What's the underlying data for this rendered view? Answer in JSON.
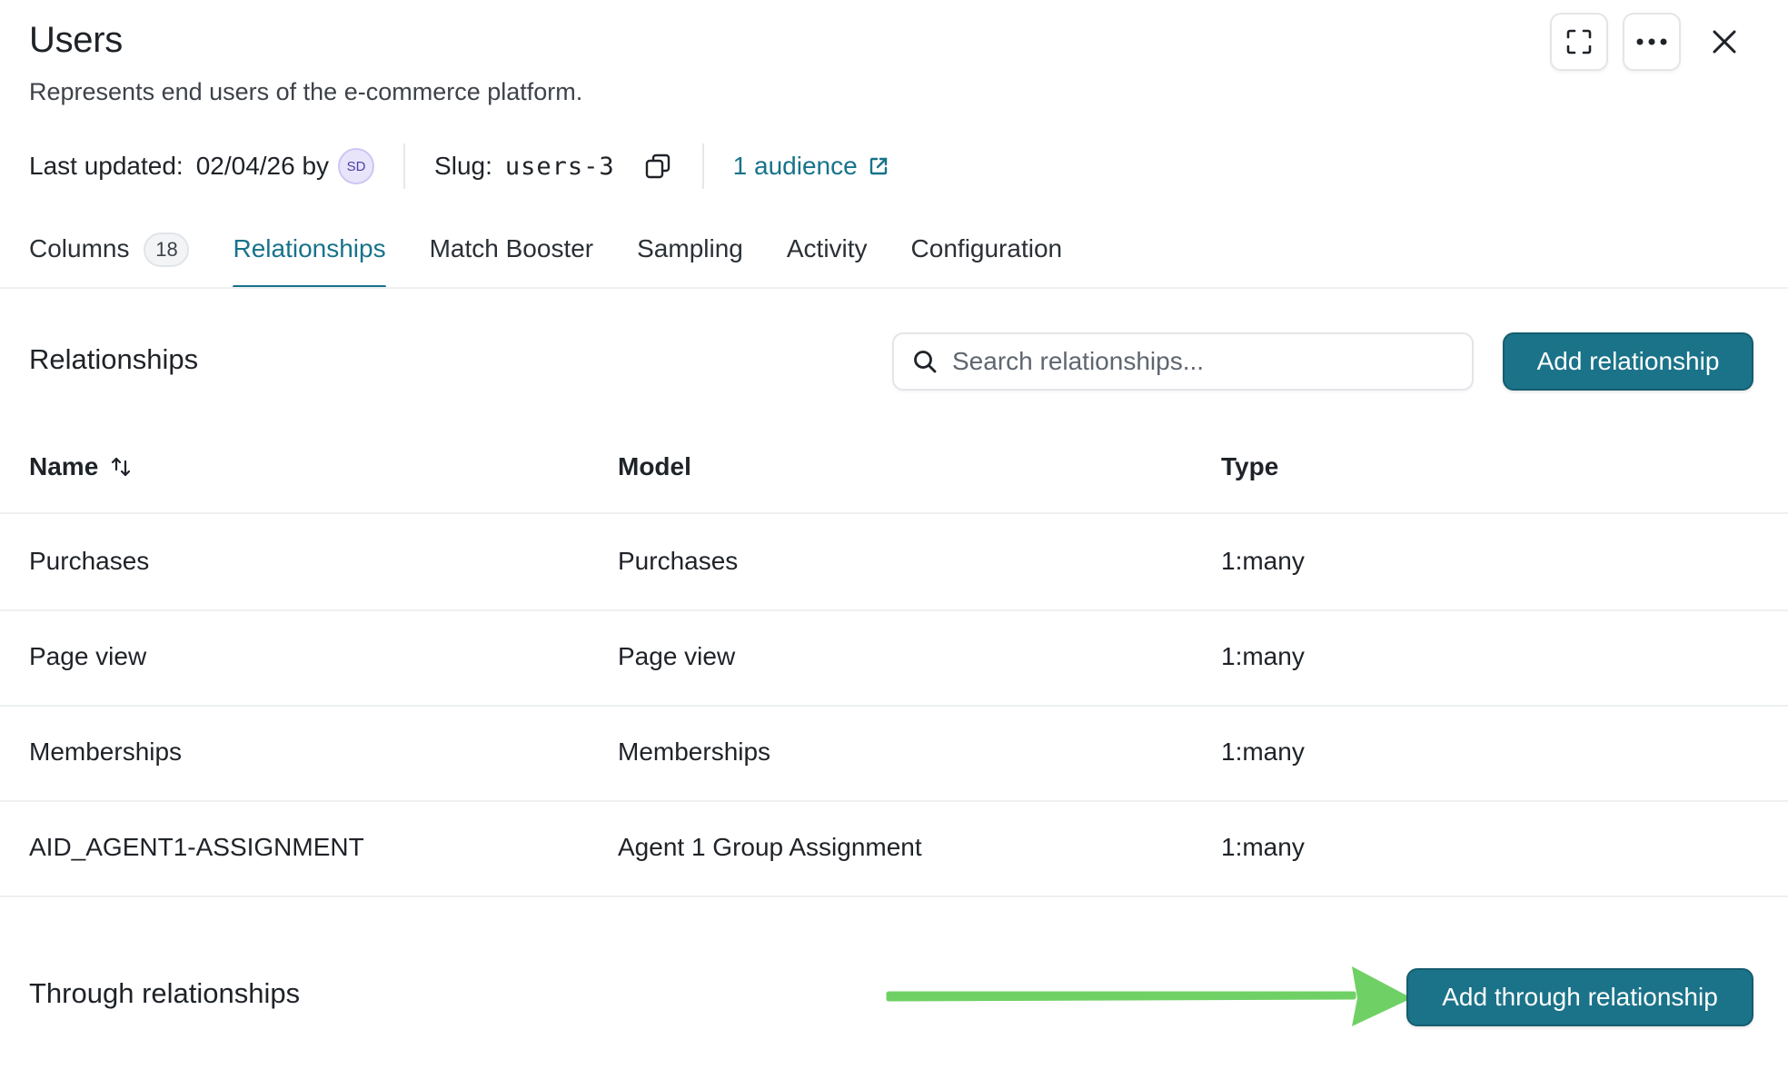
{
  "header": {
    "title": "Users",
    "description": "Represents end users of the e-commerce platform.",
    "actions": {
      "fullscreen_icon": "expand-corners-icon",
      "more_icon": "more-horizontal-icon",
      "close_icon": "close-icon"
    }
  },
  "meta": {
    "last_updated_label": "Last updated:",
    "last_updated_value": "02/04/26 by",
    "user_initials": "SD",
    "slug_label": "Slug:",
    "slug_value": "users-3",
    "copy_icon": "copy-icon",
    "audience_link": "1 audience",
    "external_icon": "external-link-icon"
  },
  "tabs": [
    {
      "label": "Columns",
      "count": "18",
      "active": false
    },
    {
      "label": "Relationships",
      "active": true
    },
    {
      "label": "Match Booster",
      "active": false
    },
    {
      "label": "Sampling",
      "active": false
    },
    {
      "label": "Activity",
      "active": false
    },
    {
      "label": "Configuration",
      "active": false
    }
  ],
  "relationships": {
    "title": "Relationships",
    "search_placeholder": "Search relationships...",
    "add_button": "Add relationship",
    "columns": {
      "name": "Name",
      "model": "Model",
      "type": "Type"
    },
    "rows": [
      {
        "name": "Purchases",
        "model": "Purchases",
        "type": "1:many"
      },
      {
        "name": "Page view",
        "model": "Page view",
        "type": "1:many"
      },
      {
        "name": "Memberships",
        "model": "Memberships",
        "type": "1:many"
      },
      {
        "name": "AID_AGENT1-ASSIGNMENT",
        "model": "Agent 1 Group Assignment",
        "type": "1:many"
      }
    ]
  },
  "through_relationships": {
    "title": "Through relationships",
    "add_button": "Add through relationship"
  },
  "colors": {
    "accent": "#17738a",
    "primary_button": "#1b7389",
    "annotation_arrow": "#6fd165"
  }
}
